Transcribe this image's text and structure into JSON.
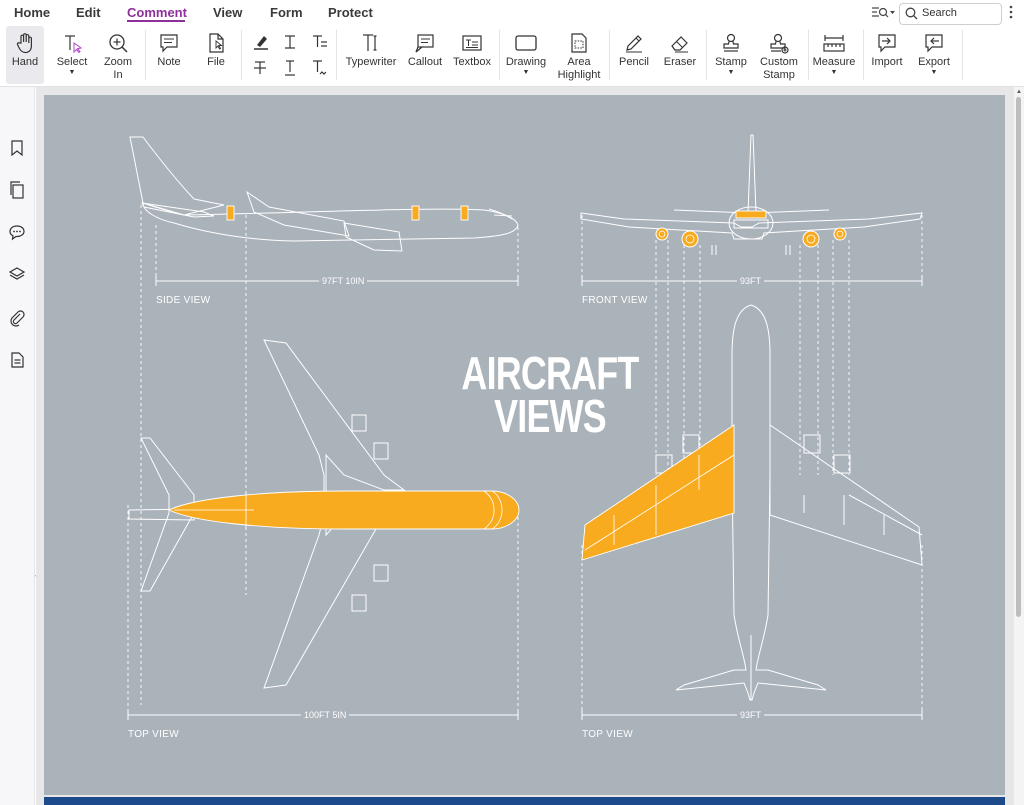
{
  "menubar": {
    "items": [
      {
        "label": "Home"
      },
      {
        "label": "Edit"
      },
      {
        "label": "Comment",
        "active": true
      },
      {
        "label": "View"
      },
      {
        "label": "Form"
      },
      {
        "label": "Protect"
      }
    ],
    "search_placeholder": "Search",
    "accent_color": "#8e2f9c"
  },
  "ribbon": {
    "hand": "Hand",
    "select": "Select",
    "zoom_in": "Zoom In",
    "note": "Note",
    "file": "File",
    "typewriter": "Typewriter",
    "callout": "Callout",
    "textbox": "Textbox",
    "drawing": "Drawing",
    "area_highlight": "Area Highlight",
    "pencil": "Pencil",
    "eraser": "Eraser",
    "stamp": "Stamp",
    "custom_stamp": "Custom Stamp",
    "measure": "Measure",
    "import": "Import",
    "export": "Export"
  },
  "leftpanel": {
    "icons": [
      "bookmark-icon",
      "pages-icon",
      "comments-icon",
      "layers-icon",
      "attachment-icon",
      "document-icon"
    ]
  },
  "document": {
    "title_line1": "AIRCRAFT",
    "title_line2": "VIEWS",
    "side_view": {
      "label": "SIDE VIEW",
      "dimension": "97FT 10IN"
    },
    "front_view": {
      "label": "FRONT VIEW",
      "dimension": "93FT"
    },
    "top_view": {
      "label": "TOP VIEW",
      "dimension": "100FT 5IN"
    },
    "top_view_right": {
      "label": "TOP VIEW",
      "dimension": "93FT"
    },
    "page_color": "#aab2ba",
    "highlight_color": "#f8ab1e"
  }
}
